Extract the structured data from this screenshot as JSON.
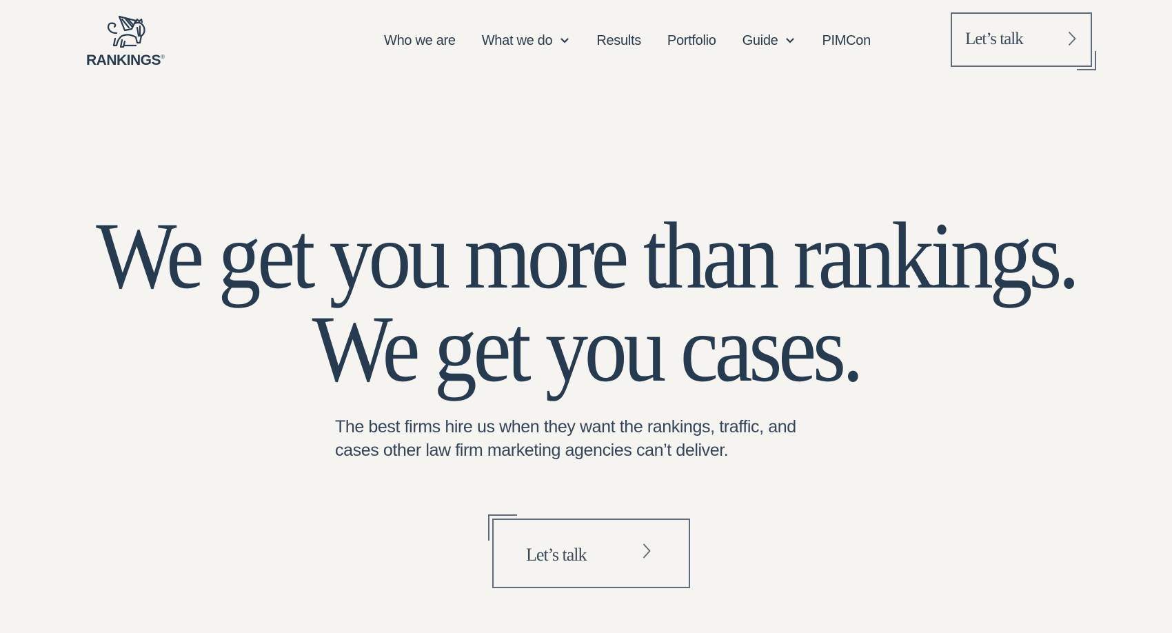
{
  "brand": {
    "name": "RANKINGS",
    "registered_mark": "®",
    "logo_icon": "winged-lion-icon"
  },
  "nav": {
    "items": [
      {
        "label": "Who we are",
        "has_dropdown": false
      },
      {
        "label": "What we do",
        "has_dropdown": true
      },
      {
        "label": "Results",
        "has_dropdown": false
      },
      {
        "label": "Portfolio",
        "has_dropdown": false
      },
      {
        "label": "Guide",
        "has_dropdown": true
      },
      {
        "label": "PIMCon",
        "has_dropdown": false
      }
    ],
    "cta": {
      "label": "Let’s talk",
      "icon": "chevron-right-icon"
    }
  },
  "hero": {
    "headline_line_1": "We get you more than rankings.",
    "headline_line_2": "We get you cases.",
    "subtext_line_1": "The best firms hire us when they want the rankings, traffic, and",
    "subtext_line_2": "cases other law firm marketing agencies can’t deliver.",
    "cta": {
      "label": "Let’s talk",
      "icon": "chevron-right-icon"
    }
  },
  "colors": {
    "background": "#f5f4f0",
    "text": "#263a50",
    "border": "#5d6b7a"
  }
}
